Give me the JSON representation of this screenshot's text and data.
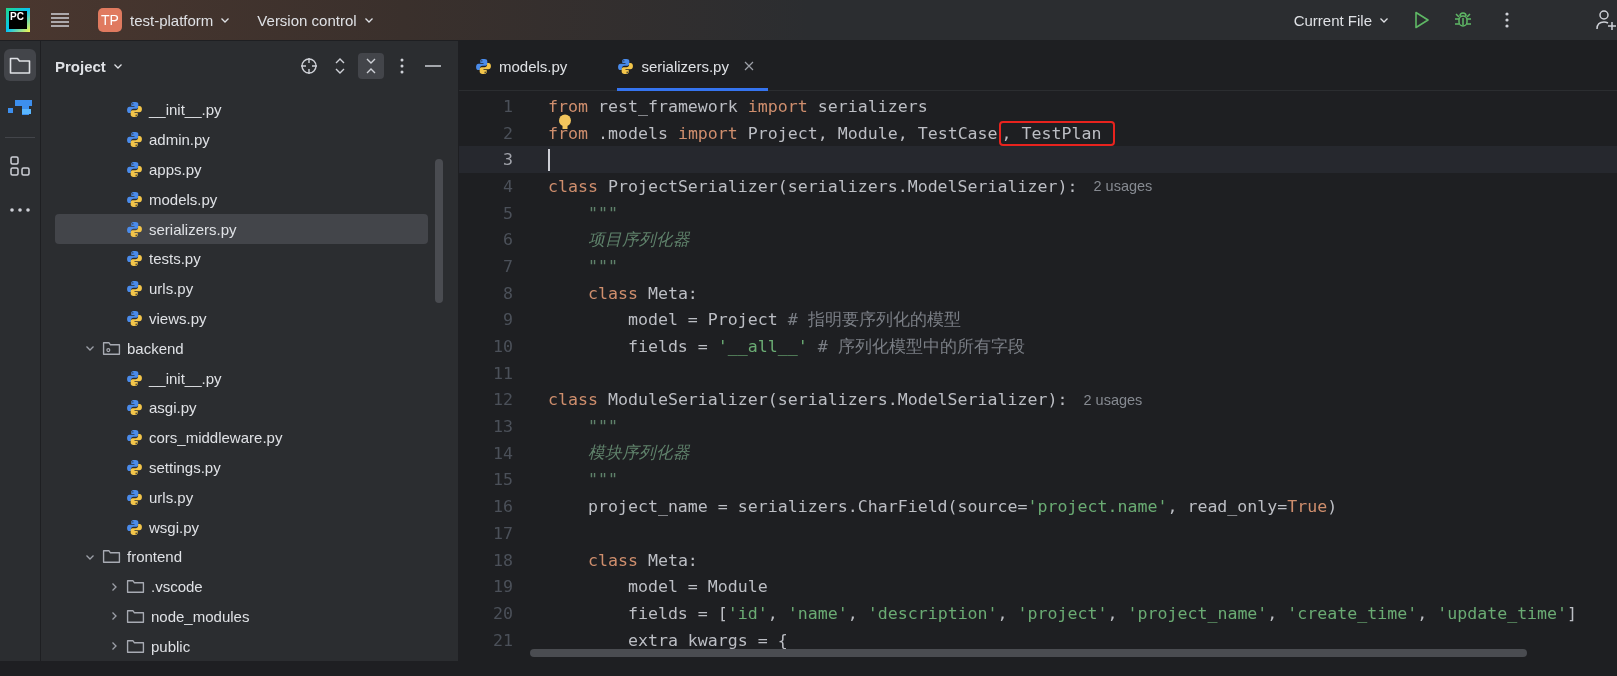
{
  "title_bar": {
    "logo": "PC",
    "project_badge": "TP",
    "project_name": "test-platform",
    "vcs": "Version control",
    "run_config": "Current File"
  },
  "project_panel": {
    "title": "Project",
    "tree": {
      "continued": [
        {
          "label": "__init__.py",
          "kind": "python",
          "selected": false
        },
        {
          "label": "admin.py",
          "kind": "python",
          "selected": false
        },
        {
          "label": "apps.py",
          "kind": "python",
          "selected": false
        },
        {
          "label": "models.py",
          "kind": "python",
          "selected": false
        },
        {
          "label": "serializers.py",
          "kind": "python",
          "selected": true
        },
        {
          "label": "tests.py",
          "kind": "python",
          "selected": false
        },
        {
          "label": "urls.py",
          "kind": "python",
          "selected": false
        },
        {
          "label": "views.py",
          "kind": "python",
          "selected": false
        }
      ],
      "items": [
        {
          "label": "backend",
          "kind": "package",
          "selected": false,
          "expanded": true,
          "children": [
            {
              "label": "__init__.py",
              "kind": "python",
              "selected": false
            },
            {
              "label": "asgi.py",
              "kind": "python",
              "selected": false
            },
            {
              "label": "cors_middleware.py",
              "kind": "python",
              "selected": false
            },
            {
              "label": "settings.py",
              "kind": "python",
              "selected": false
            },
            {
              "label": "urls.py",
              "kind": "python",
              "selected": false
            },
            {
              "label": "wsgi.py",
              "kind": "python",
              "selected": false
            }
          ]
        },
        {
          "label": "frontend",
          "kind": "folder",
          "selected": false,
          "expanded": true,
          "children": [
            {
              "label": ".vscode",
              "kind": "folder",
              "selected": false,
              "expanded": false
            },
            {
              "label": "node_modules",
              "kind": "folder",
              "selected": false,
              "expanded": false
            },
            {
              "label": "public",
              "kind": "folder",
              "selected": false,
              "expanded": false
            }
          ]
        }
      ]
    }
  },
  "tabs": [
    {
      "label": "models.py",
      "selected": false
    },
    {
      "label": "serializers.py",
      "selected": true
    }
  ],
  "editor": {
    "lines": [
      {
        "number": "1",
        "current": false,
        "tokens": [
          {
            "text": "from",
            "kind": "kw"
          },
          {
            "text": " rest_framework ",
            "kind": "plain"
          },
          {
            "text": "import",
            "kind": "kw"
          },
          {
            "text": " serializers",
            "kind": "plain"
          }
        ]
      },
      {
        "number": "2",
        "current": false,
        "bulb": true,
        "tokens": [
          {
            "text": "from",
            "kind": "kw"
          },
          {
            "text": " .models ",
            "kind": "plain"
          },
          {
            "text": "import",
            "kind": "kw"
          },
          {
            "text": " Project, Module, TestCase",
            "kind": "plain"
          },
          {
            "text": ", TestPlan",
            "kind": "plain",
            "boxed": true
          }
        ]
      },
      {
        "number": "3",
        "current": true
      },
      {
        "number": "4",
        "current": false,
        "hint": "2 usages",
        "tokens": [
          {
            "text": "class",
            "kind": "kw"
          },
          {
            "text": " ProjectSerializer(serializers.ModelSerializer):",
            "kind": "plain"
          }
        ]
      },
      {
        "number": "5",
        "current": false,
        "tokens": [
          {
            "text": "    \"\"\"",
            "kind": "doc"
          }
        ]
      },
      {
        "number": "6",
        "current": false,
        "tokens": [
          {
            "text": "    项目序列化器",
            "kind": "doc"
          }
        ]
      },
      {
        "number": "7",
        "current": false,
        "tokens": [
          {
            "text": "    \"\"\"",
            "kind": "doc"
          }
        ]
      },
      {
        "number": "8",
        "current": false,
        "tokens": [
          {
            "text": "    class",
            "kind": "kw"
          },
          {
            "text": " Meta:",
            "kind": "plain"
          }
        ]
      },
      {
        "number": "9",
        "current": false,
        "tokens": [
          {
            "text": "        model = Project ",
            "kind": "plain"
          },
          {
            "text": "# 指明要序列化的模型",
            "kind": "cmt"
          }
        ]
      },
      {
        "number": "10",
        "current": false,
        "tokens": [
          {
            "text": "        fields = ",
            "kind": "plain"
          },
          {
            "text": "'__all__'",
            "kind": "str"
          },
          {
            "text": " # 序列化模型中的所有字段",
            "kind": "cmt"
          }
        ]
      },
      {
        "number": "11",
        "current": false
      },
      {
        "number": "12",
        "current": false,
        "hint": "2 usages",
        "tokens": [
          {
            "text": "class",
            "kind": "kw"
          },
          {
            "text": " ModuleSerializer(serializers.ModelSerializer):",
            "kind": "plain"
          }
        ]
      },
      {
        "number": "13",
        "current": false,
        "tokens": [
          {
            "text": "    \"\"\"",
            "kind": "doc"
          }
        ]
      },
      {
        "number": "14",
        "current": false,
        "tokens": [
          {
            "text": "    模块序列化器",
            "kind": "doc"
          }
        ]
      },
      {
        "number": "15",
        "current": false,
        "tokens": [
          {
            "text": "    \"\"\"",
            "kind": "doc"
          }
        ]
      },
      {
        "number": "16",
        "current": false,
        "tokens": [
          {
            "text": "    project_name = serializers.CharField(source=",
            "kind": "plain"
          },
          {
            "text": "'project.name'",
            "kind": "str"
          },
          {
            "text": ", read_only=",
            "kind": "plain"
          },
          {
            "text": "True",
            "kind": "kw"
          },
          {
            "text": ")",
            "kind": "plain"
          }
        ]
      },
      {
        "number": "17",
        "current": false
      },
      {
        "number": "18",
        "current": false,
        "tokens": [
          {
            "text": "    class",
            "kind": "kw"
          },
          {
            "text": " Meta:",
            "kind": "plain"
          }
        ]
      },
      {
        "number": "19",
        "current": false,
        "tokens": [
          {
            "text": "        model = Module",
            "kind": "plain"
          }
        ]
      },
      {
        "number": "20",
        "current": false,
        "tokens": [
          {
            "text": "        fields = [",
            "kind": "plain"
          },
          {
            "text": "'id'",
            "kind": "str"
          },
          {
            "text": ", ",
            "kind": "plain"
          },
          {
            "text": "'name'",
            "kind": "str"
          },
          {
            "text": ", ",
            "kind": "plain"
          },
          {
            "text": "'description'",
            "kind": "str"
          },
          {
            "text": ", ",
            "kind": "plain"
          },
          {
            "text": "'project'",
            "kind": "str"
          },
          {
            "text": ", ",
            "kind": "plain"
          },
          {
            "text": "'project_name'",
            "kind": "str"
          },
          {
            "text": ", ",
            "kind": "plain"
          },
          {
            "text": "'create_time'",
            "kind": "str"
          },
          {
            "text": ", ",
            "kind": "plain"
          },
          {
            "text": "'update_time'",
            "kind": "str"
          },
          {
            "text": "]",
            "kind": "plain"
          }
        ]
      },
      {
        "number": "21",
        "current": false,
        "tokens": [
          {
            "text": "        extra_kwargs = {",
            "kind": "plain"
          }
        ]
      }
    ]
  }
}
